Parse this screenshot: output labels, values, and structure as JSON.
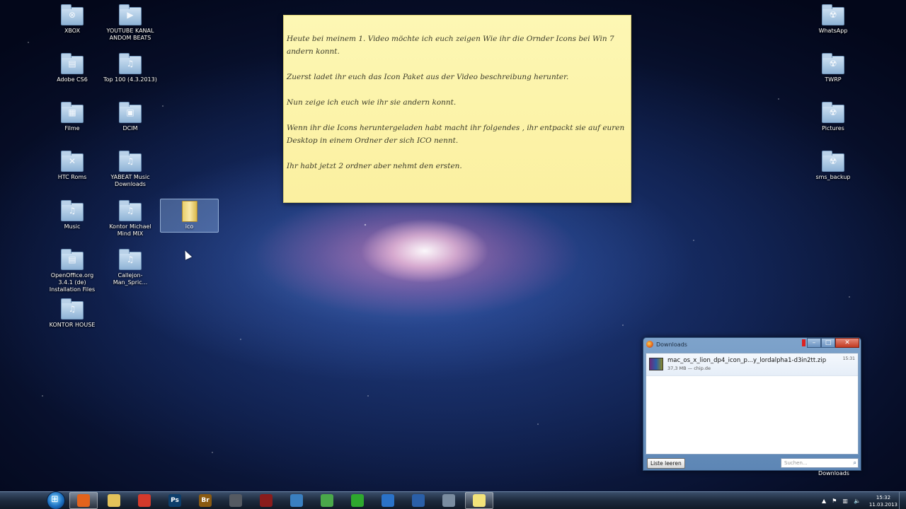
{
  "desktop_icons_left": [
    {
      "label": "XBOX",
      "glyph": "⊗"
    },
    {
      "label": "YOUTUBE KANAL ANDOM BEATS",
      "glyph": "▶"
    },
    {
      "label": "Adobe CS6",
      "glyph": "▤"
    },
    {
      "label": "Top 100 (4.3.2013)",
      "glyph": "♫"
    },
    {
      "label": "Filme",
      "glyph": "▦"
    },
    {
      "label": "DCIM",
      "glyph": "▣"
    },
    {
      "label": "HTC Roms",
      "glyph": "✕"
    },
    {
      "label": "YABEAT Music Downloads",
      "glyph": "♫"
    },
    {
      "label": "Music",
      "glyph": "♫"
    },
    {
      "label": "Kontor Michael Mind MIX",
      "glyph": "♫"
    },
    {
      "label": "OpenOffice.org 3.4.1 (de) Installation Files",
      "glyph": "▤"
    },
    {
      "label": "Callejon-Man_Spric...",
      "glyph": "♫"
    },
    {
      "label": "KONTOR HOUSE",
      "glyph": "♫"
    }
  ],
  "selected_icon": {
    "label": "ico"
  },
  "desktop_icons_right": [
    {
      "label": "WhatsApp",
      "glyph": "☢"
    },
    {
      "label": "TWRP",
      "glyph": "☢"
    },
    {
      "label": "Pictures",
      "glyph": "☢"
    },
    {
      "label": "sms_backup",
      "glyph": "☢"
    }
  ],
  "sticky_note": {
    "paragraphs": [
      "Heute bei meinem 1. Video möchte ich euch zeigen Wie ihr die Ornder Icons bei Win 7 andern konnt.",
      "Zuerst ladet ihr euch das Icon Paket aus der Video beschreibung herunter.",
      "Nun zeige ich euch wie ihr sie andern konnt.",
      "Wenn ihr die Icons heruntergeladen habt macht ihr folgendes ,  ihr entpackt sie auf euren Desktop in einem Ordner der sich ICO nennt.",
      "Ihr habt jetzt 2 ordner aber nehmt den ersten."
    ]
  },
  "downloads_window": {
    "title": "Downloads",
    "item": {
      "filename": "mac_os_x_lion_dp4_icon_p...y_lordalpha1-d3in2tt.zip",
      "details": "37,3 MB — chip.de",
      "time": "15:31"
    },
    "clear_button": "Liste leeren",
    "search_placeholder": "Suchen...",
    "below_label": "Downloads"
  },
  "taskbar": {
    "apps": [
      {
        "name": "firefox",
        "label": "",
        "color": "#e2631c",
        "active": true
      },
      {
        "name": "explorer",
        "label": "",
        "color": "#e3c25a",
        "active": false
      },
      {
        "name": "chrome",
        "label": "",
        "color": "#d33a2c",
        "active": false
      },
      {
        "name": "photoshop",
        "label": "Ps",
        "color": "#0d3e6b",
        "active": false
      },
      {
        "name": "bridge",
        "label": "Br",
        "color": "#8a5a12",
        "active": false
      },
      {
        "name": "utility",
        "label": "",
        "color": "#555a62",
        "active": false
      },
      {
        "name": "sothink",
        "label": "",
        "color": "#8a1c1c",
        "active": false
      },
      {
        "name": "earth",
        "label": "",
        "color": "#3a7fc0",
        "active": false
      },
      {
        "name": "bluestacks",
        "label": "",
        "color": "#4aa84a",
        "active": false
      },
      {
        "name": "media",
        "label": "",
        "color": "#2ea82e",
        "active": false
      },
      {
        "name": "itunes",
        "label": "",
        "color": "#2a72c8",
        "active": false
      },
      {
        "name": "globe",
        "label": "",
        "color": "#2a5fa8",
        "active": false
      },
      {
        "name": "video",
        "label": "",
        "color": "#7a8ca0",
        "active": false
      },
      {
        "name": "sticky-notes",
        "label": "",
        "color": "#f3e37a",
        "active": true
      }
    ],
    "clock_time": "15:32",
    "clock_date": "11.03.2013"
  }
}
